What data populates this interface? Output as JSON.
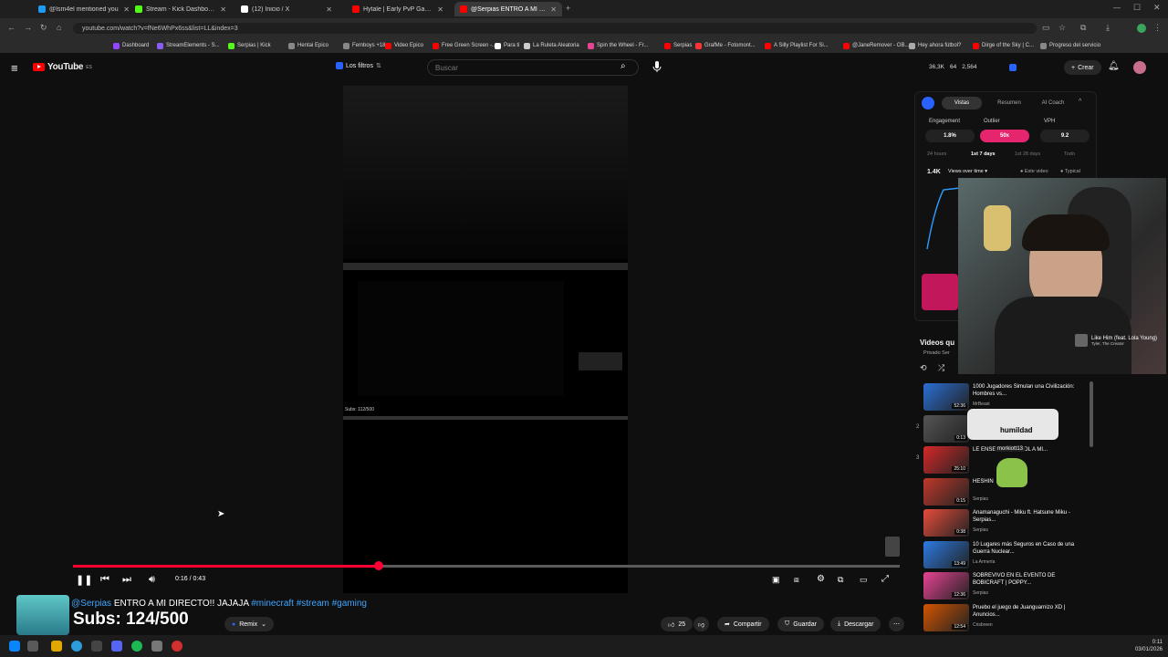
{
  "browser": {
    "tabs": [
      {
        "label": "@Ism4el mentioned you",
        "color": "#1d9bf0"
      },
      {
        "label": "Stream - Kick Dashboard",
        "color": "#53fc18"
      },
      {
        "label": "(12) Inicio / X",
        "color": "#ffffff"
      },
      {
        "label": "Hytale | Early PvP Gameplay D...",
        "color": "#ff0000"
      },
      {
        "label": "@Serpias ENTRO A MI DIR...",
        "color": "#ff0000"
      }
    ],
    "url": "youtube.com/watch?v=fNe6WhPx6ss&list=LL&index=3",
    "bookmarks": [
      {
        "label": "Dashboard",
        "color": "#9146ff"
      },
      {
        "label": "StreamElements - S...",
        "color": "#8b5cf6"
      },
      {
        "label": "Serpias | Kick",
        "color": "#53fc18"
      },
      {
        "label": "Hentai Epico",
        "color": "#888888"
      },
      {
        "label": "Femboys +18",
        "color": "#888888"
      },
      {
        "label": "Video Epico",
        "color": "#ff0000"
      },
      {
        "label": "Free Green Screen -...",
        "color": "#ff0000"
      },
      {
        "label": "Para ti",
        "color": "#ffffff"
      },
      {
        "label": "La Ruleta Aleatoria",
        "color": "#cccccc"
      },
      {
        "label": "Spin the Wheel - Fr...",
        "color": "#e84393"
      },
      {
        "label": "Serpias",
        "color": "#ff0000"
      },
      {
        "label": "GrafMe - Fotomont...",
        "color": "#ff3333"
      },
      {
        "label": "A Silly Playlist For Si...",
        "color": "#ff0000"
      },
      {
        "label": "@JaneRemover - OB...",
        "color": "#ff0000"
      },
      {
        "label": "Hey ahora fútbol?",
        "color": "#aaaaaa"
      },
      {
        "label": "Dirge of the Sky | C...",
        "color": "#ff0000"
      },
      {
        "label": "Progreso del servicio",
        "color": "#888888"
      }
    ]
  },
  "youtube": {
    "logo": "YouTube",
    "logo_sup": "ES",
    "filter_label": "Los filtros",
    "search_placeholder": "Buscar",
    "stats": {
      "views": "36,3K",
      "a": "64",
      "b": "2,564"
    },
    "create_label": "Crear"
  },
  "player": {
    "time": "0:16 / 0:43",
    "progress": 0.37,
    "subs_overlay": "Subs: 112/500"
  },
  "vidiq": {
    "tabs": [
      "Vistas",
      "Resumen",
      "AI Coach"
    ],
    "metrics": [
      {
        "label": "Engagement",
        "value": "1.8%"
      },
      {
        "label": "Outlier",
        "value": "50x"
      },
      {
        "label": "VPH",
        "value": "9.2"
      }
    ],
    "ranges": [
      "24 hours",
      "1st 7 days",
      "1st 28 days",
      "Todo"
    ],
    "views_count": "1.4K",
    "views_mode": "Views over time",
    "legend": [
      "Este video",
      "Typical"
    ]
  },
  "now_playing": {
    "title": "Like Him (feat. Lola Young)",
    "artist": "Tyler, The Creator"
  },
  "playlist": {
    "heading": "Videos qu",
    "private_label": "Privado Ser",
    "items": [
      {
        "num": "",
        "title": "1000 Jugadores Simulan una Civilización: Hombres vs...",
        "channel": "MrBeast",
        "duration": "52:36",
        "color": "#2a6fd6"
      },
      {
        "num": "2",
        "title": "",
        "channel": "",
        "duration": "0:13",
        "color": "#555555"
      },
      {
        "num": "3",
        "title": "LE ENSEÑO ESPAÑOL A MI...",
        "channel": "",
        "duration": "25:10",
        "color": "#d62828"
      },
      {
        "num": "",
        "title": "HESHIN",
        "channel": "Serpias",
        "duration": "0:15",
        "color": "#c0392b"
      },
      {
        "num": "",
        "title": "Anamanaguchi - Miku ft. Hatsune Miku - Serpias...",
        "channel": "Serpias",
        "duration": "0:38",
        "color": "#e74c3c"
      },
      {
        "num": "",
        "title": "10 Lugares más Seguros en Caso de una Guerra Nuclear...",
        "channel": "La Armería",
        "duration": "13:49",
        "color": "#2c7be5"
      },
      {
        "num": "",
        "title": "SOBREVIVO EN EL EVENTO DE BOBICRAFT | POPPY...",
        "channel": "Serpias",
        "duration": "12:36",
        "color": "#e84393"
      },
      {
        "num": "",
        "title": "Pruebo el juego de Juanguarnizo XD | Anuncios...",
        "channel": "Crisbreen",
        "duration": "12:54",
        "color": "#d35400"
      }
    ]
  },
  "overlays": {
    "humildad": "humildad",
    "morkiott": "morkiott13",
    "subs_big": "Subs: 124/500"
  },
  "video_info": {
    "channel": "@Serpias",
    "title": "ENTRO A MI DIRECTO!! JAJAJA",
    "tags": "#minecraft #stream #gaming",
    "remix": "Remix",
    "likes": "25",
    "share": "Compartir",
    "save": "Guardar",
    "download": "Descargar"
  },
  "taskbar": {
    "time": "0:11",
    "date": "03/01/2026"
  }
}
